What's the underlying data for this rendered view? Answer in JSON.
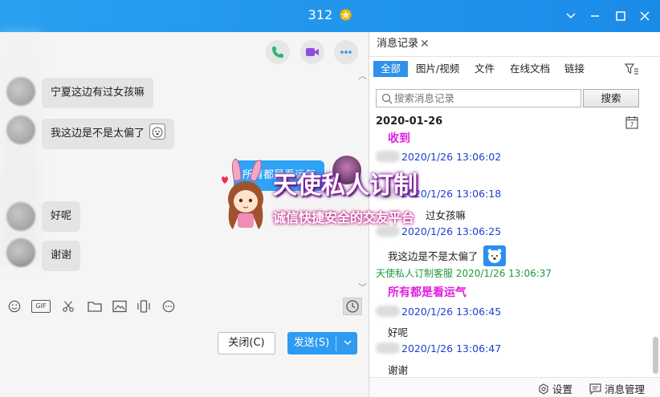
{
  "window": {
    "title": "312",
    "controls": [
      "chevron-down-icon",
      "minimize-icon",
      "maximize-icon",
      "close-icon"
    ]
  },
  "chat": {
    "header_buttons": [
      "phone-icon",
      "video-icon",
      "more-icon"
    ],
    "messages": [
      {
        "side": "left",
        "text": "宁夏这边有过女孩嘛"
      },
      {
        "side": "left",
        "text": "我这边是不是太偏了"
      },
      {
        "side": "right",
        "text": "所有都是看运气"
      },
      {
        "side": "left",
        "text": "好呢"
      },
      {
        "side": "left",
        "text": "谢谢"
      }
    ],
    "toolbar_icons": [
      "emoji-icon",
      "gif-icon",
      "scissors-icon",
      "folder-icon",
      "image-icon",
      "shake-icon",
      "more-icon"
    ],
    "gif_label": "GIF",
    "close_button": "关闭(C)",
    "send_button": "发送(S)"
  },
  "history": {
    "tab_label": "消息记录",
    "filters": [
      "全部",
      "图片/视频",
      "文件",
      "在线文档",
      "链接"
    ],
    "active_filter": "全部",
    "search_placeholder": "搜索消息记录",
    "search_button": "搜索",
    "date": "2020-01-26",
    "entries": [
      {
        "kind": "pink",
        "text": "收到"
      },
      {
        "kind": "time",
        "text": "2020/1/26 13:06:02"
      },
      {
        "kind": "time",
        "text": "2020/1/26 13:06:18"
      },
      {
        "kind": "text",
        "text": "过女孩嘛"
      },
      {
        "kind": "time",
        "text": "2020/1/26 13:06:25"
      },
      {
        "kind": "text",
        "text": "我这边是不是太偏了"
      },
      {
        "kind": "service",
        "text": "天使私人订制客服  2020/1/26 13:06:37"
      },
      {
        "kind": "pink",
        "text": "所有都是看运气"
      },
      {
        "kind": "time",
        "text": "2020/1/26 13:06:45"
      },
      {
        "kind": "text",
        "text": "好呢"
      },
      {
        "kind": "time",
        "text": "2020/1/26 13:06:47"
      },
      {
        "kind": "text",
        "text": "谢谢"
      }
    ],
    "settings_label": "设置",
    "manage_label": "消息管理"
  },
  "watermark": {
    "title": "天使私人订制",
    "subtitle": "诚信快捷安全的交友平台"
  },
  "colors": {
    "titlebar": "#1b8be8",
    "accent": "#2f91ea",
    "pink": "#e020e0",
    "time_blue": "#1f3fcf",
    "service_green": "#1c9a3a"
  }
}
